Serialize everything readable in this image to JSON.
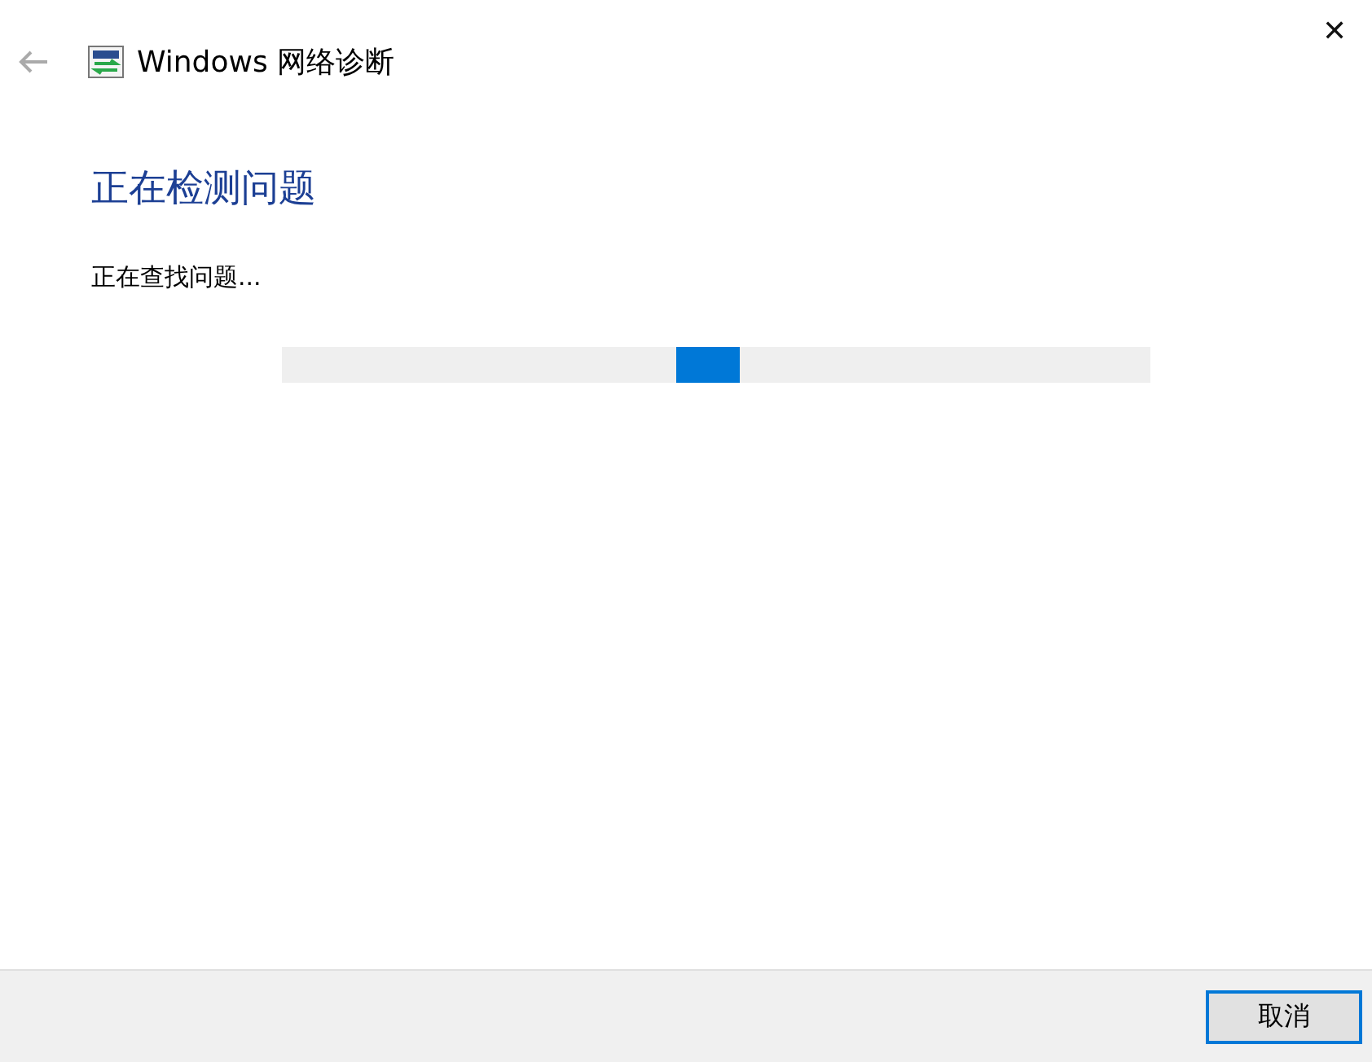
{
  "window": {
    "title": "Windows 网络诊断",
    "close": "✕"
  },
  "back_button": {
    "disabled": true
  },
  "heading": "正在检测问题",
  "status": "正在查找问题...",
  "progress": {
    "indeterminate": true
  },
  "buttons": [
    {
      "label": "取消",
      "focused": true
    }
  ]
}
